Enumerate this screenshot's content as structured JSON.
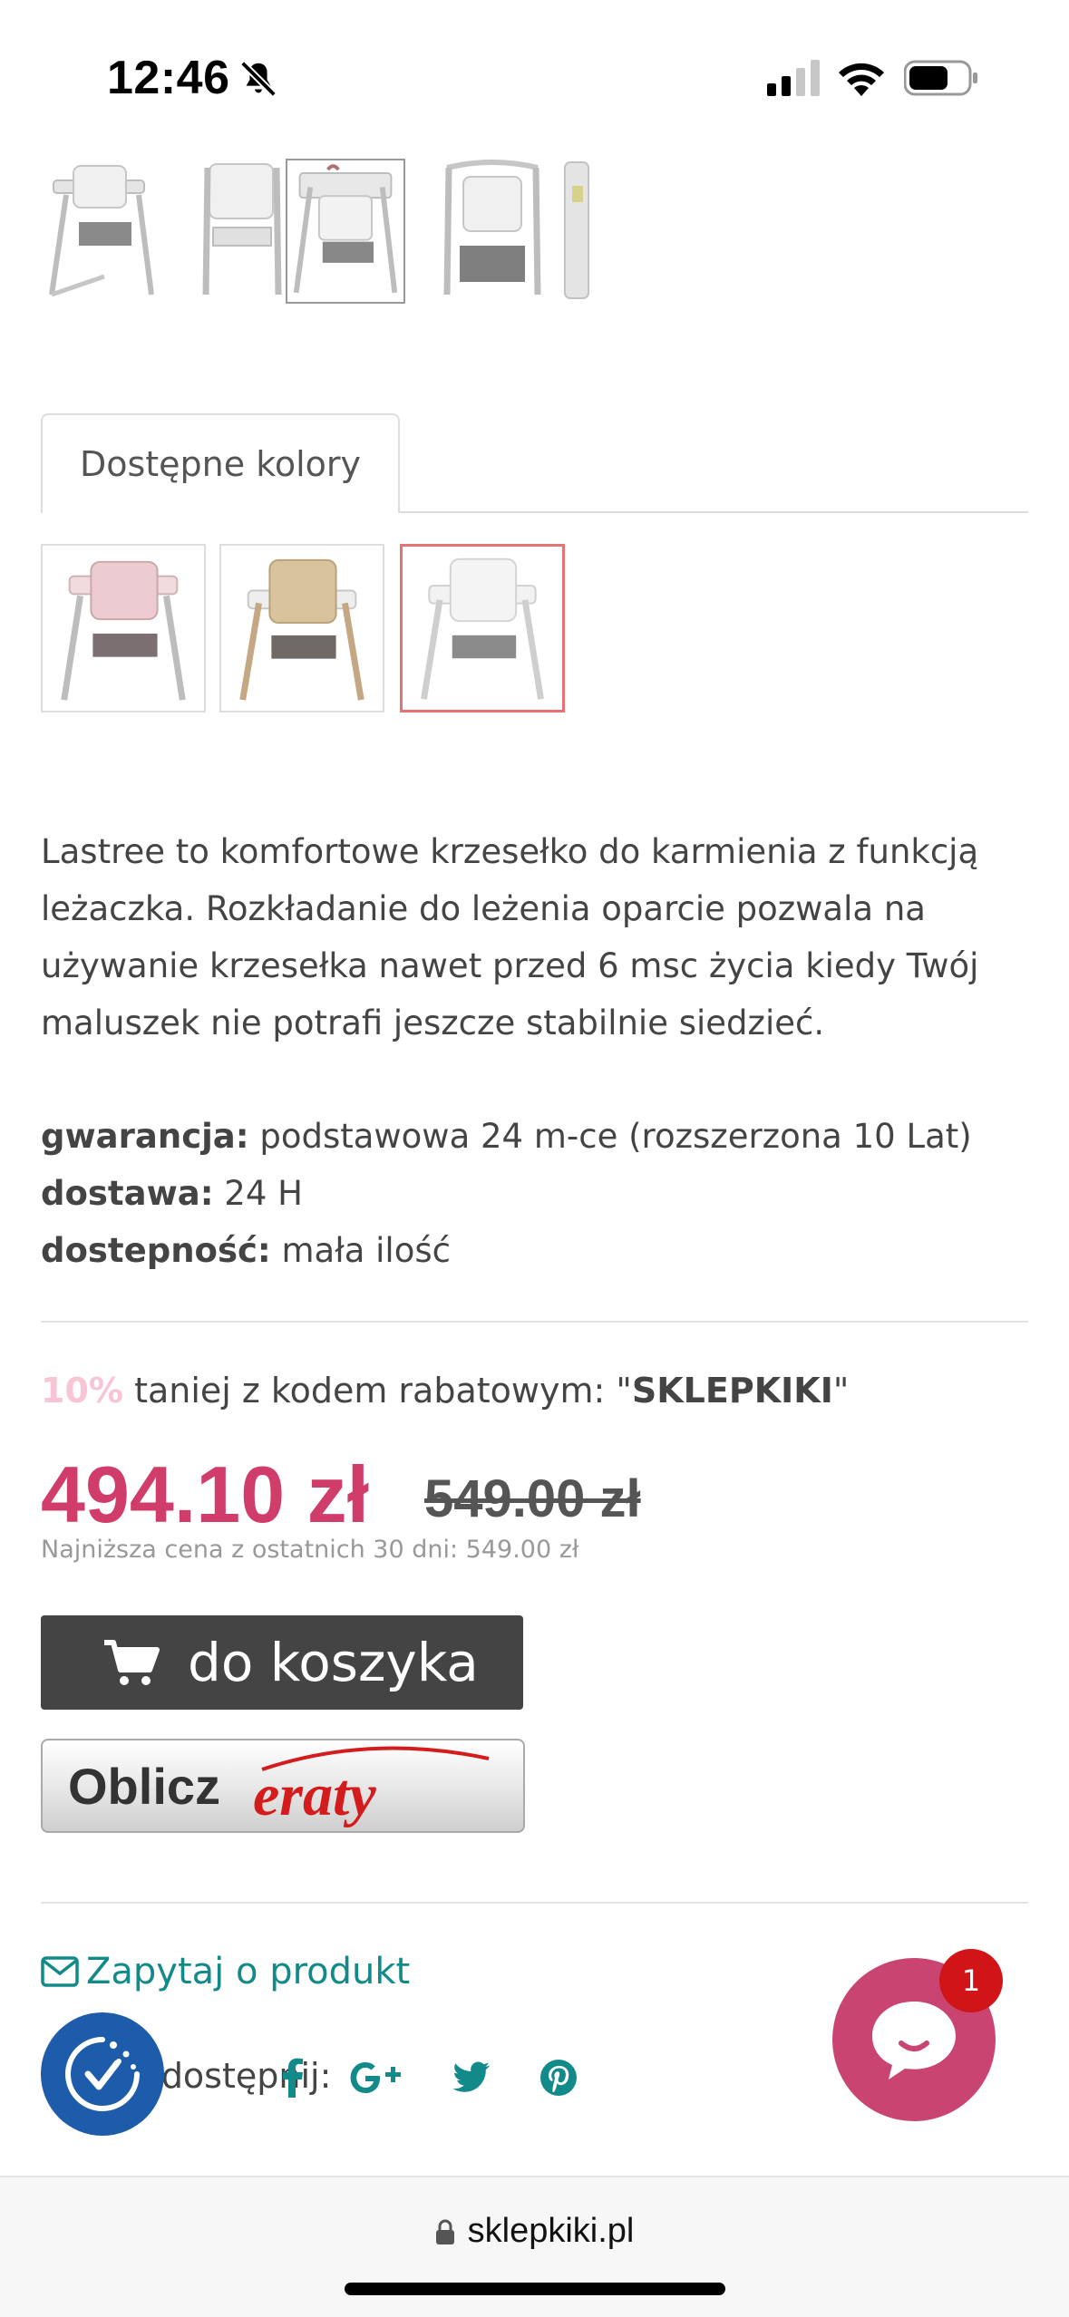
{
  "status_bar": {
    "time": "12:46",
    "icons": [
      "bell-off-icon",
      "signal-icon",
      "wifi-icon",
      "battery-icon"
    ]
  },
  "gallery": {
    "thumbnails": [
      "highchair-front",
      "highchair-reclined",
      "highchair-toy-bar",
      "highchair-swing",
      "highchair-folded"
    ],
    "active_index": 2
  },
  "tabs": {
    "colors_label": "Dostępne kolory"
  },
  "color_options": [
    {
      "name": "pink",
      "color": "#e8c4c8",
      "selected": false
    },
    {
      "name": "beige",
      "color": "#d8c29d",
      "selected": false
    },
    {
      "name": "grey",
      "color": "#e0e0e0",
      "selected": true
    }
  ],
  "description": {
    "text": "Lastree to komfortowe krzesełko do karmienia z funkcją leżaczka. Rozkładanie do leżenia oparcie pozwala na używanie krzesełka nawet przed 6 msc życia kiedy Twój maluszek nie potrafi jeszcze stabilnie siedzieć."
  },
  "specs": {
    "warranty_label": "gwarancja:",
    "warranty_value": "podstawowa 24 m-ce (rozszerzona 10 Lat)",
    "delivery_label": "dostawa:",
    "delivery_value": "24 H",
    "availability_label": "dostepność:",
    "availability_value": "mała ilość"
  },
  "promo": {
    "percent": "10%",
    "text": "taniej z kodem rabatowym:",
    "quote_open": "\"",
    "code": "SKLEPKIKI",
    "quote_close": "\""
  },
  "price": {
    "current": "494.10 zł",
    "old": "549.00 zł",
    "lowest_note": "Najniższa cena z ostatnich 30 dni: 549.00 zł"
  },
  "cart": {
    "label": "do koszyka"
  },
  "eraty": {
    "oblicz_label": "Oblicz",
    "brand_label": "eraty"
  },
  "ask": {
    "label": "Zapytaj o produkt"
  },
  "share": {
    "label": "Udostępnij:",
    "networks": [
      "facebook-icon",
      "google-plus-icon",
      "twitter-icon",
      "pinterest-icon"
    ]
  },
  "chat": {
    "badge_count": "1"
  },
  "browser": {
    "url": "sklepkiki.pl"
  },
  "colors": {
    "price_accent": "#d13d6a",
    "link_teal": "#138a8a",
    "cart_button": "#444444",
    "chat_bubble": "#c94471",
    "cookie_button": "#1d5bab",
    "badge_red": "#d01418"
  }
}
